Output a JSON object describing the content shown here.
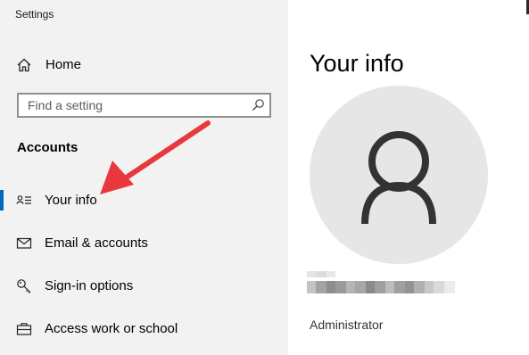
{
  "window": {
    "title": "Settings"
  },
  "sidebar": {
    "home": {
      "label": "Home",
      "icon": "home-icon"
    },
    "search": {
      "placeholder": "Find a setting",
      "value": "",
      "icon": "search-icon"
    },
    "section_heading": "Accounts",
    "items": [
      {
        "label": "Your info",
        "icon": "person-card-icon",
        "selected": true
      },
      {
        "label": "Email & accounts",
        "icon": "mail-icon",
        "selected": false
      },
      {
        "label": "Sign-in options",
        "icon": "key-icon",
        "selected": false
      },
      {
        "label": "Access work or school",
        "icon": "briefcase-icon",
        "selected": false
      }
    ]
  },
  "main": {
    "title": "Your info",
    "avatar_icon": "user-silhouette-icon",
    "account_type": "Administrator"
  },
  "colors": {
    "sidebar_bg": "#f2f2f2",
    "accent": "#0067c0",
    "annotation_arrow": "#e8383d",
    "avatar_bg": "#e6e6e6"
  }
}
